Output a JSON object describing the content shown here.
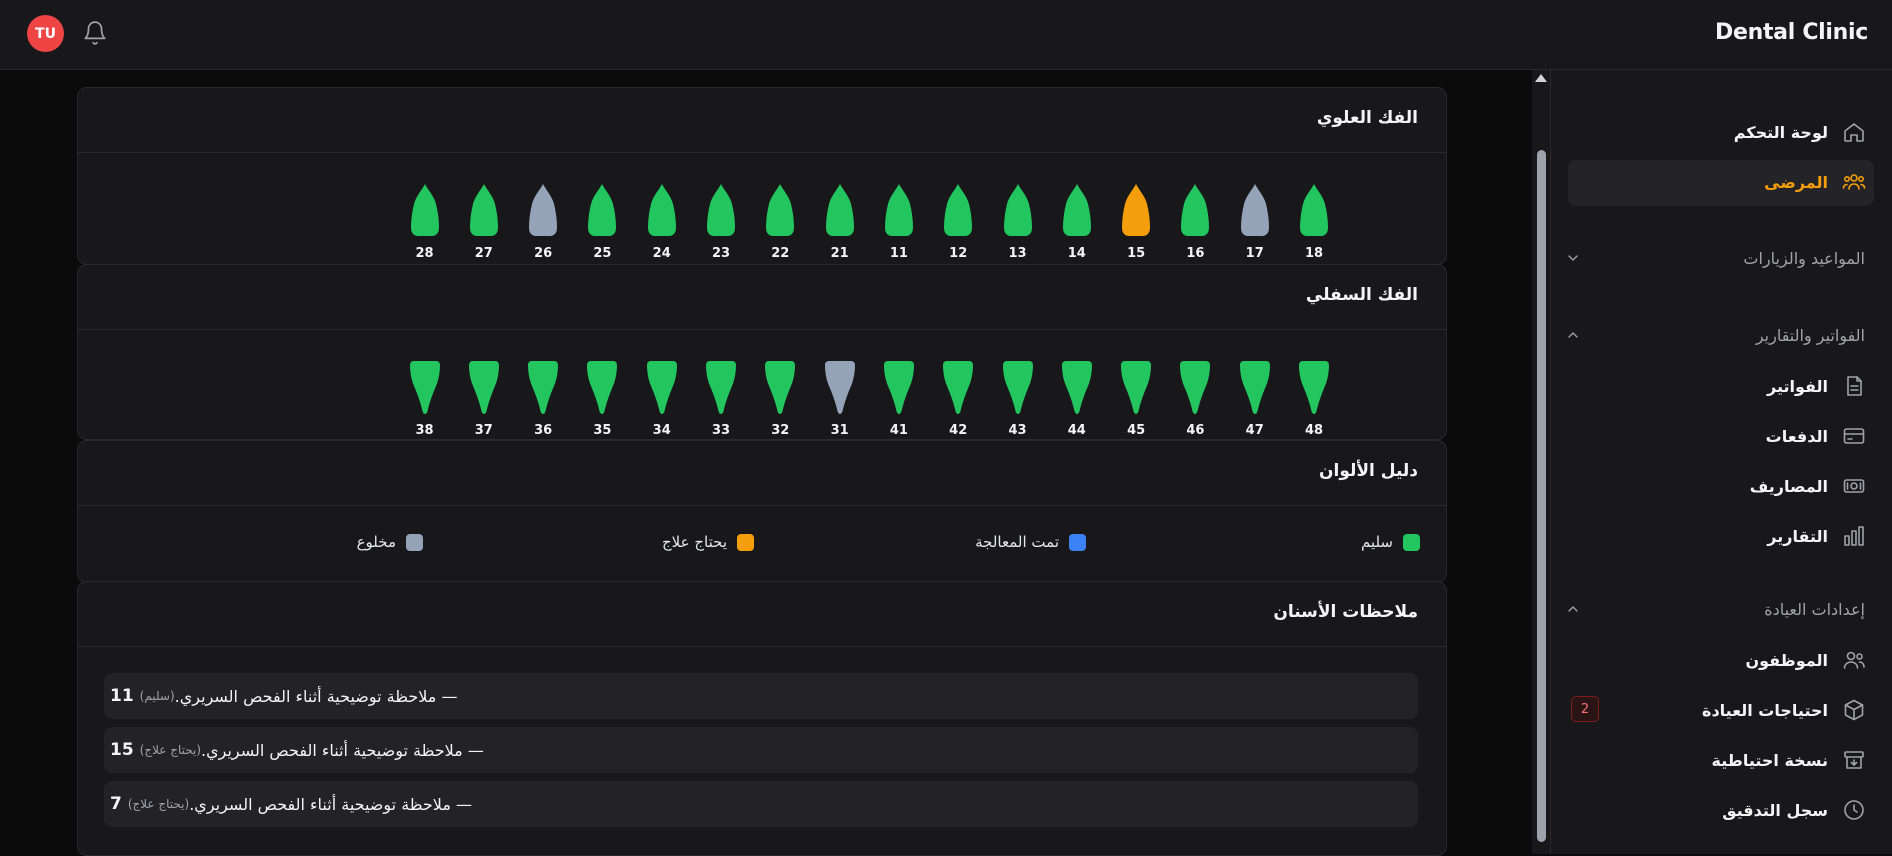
{
  "header": {
    "brand": "Dental Clinic",
    "avatar_initials": "TU",
    "avatar_color": "#ef4444",
    "bell_icon": "bell-icon"
  },
  "sidebar": {
    "items": [
      {
        "label": "لوحة التحكم",
        "icon": "home-icon"
      },
      {
        "label": "المرضى",
        "icon": "users-icon",
        "active": true,
        "color": "#f59e0b"
      }
    ],
    "sections": [
      {
        "title": "المواعيد والزيارات",
        "expanded": false
      },
      {
        "title": "الفواتير والتقارير",
        "expanded": true,
        "items": [
          {
            "label": "الفواتير",
            "icon": "document-icon"
          },
          {
            "label": "الدفعات",
            "icon": "credit-card-icon"
          },
          {
            "label": "المصاريف",
            "icon": "cash-icon"
          },
          {
            "label": "التقارير",
            "icon": "bar-chart-icon"
          }
        ]
      },
      {
        "title": "إعدادات العيادة",
        "expanded": true,
        "items": [
          {
            "label": "الموظفون",
            "icon": "users-icon"
          },
          {
            "label": "احتياجات العيادة",
            "icon": "box-icon",
            "badge": "2"
          },
          {
            "label": "نسخة احتياطية",
            "icon": "archive-icon"
          },
          {
            "label": "سجل التدقيق",
            "icon": "clock-icon"
          }
        ]
      }
    ]
  },
  "upper_jaw": {
    "title": "الفك العلوي",
    "teeth": [
      {
        "num": "18",
        "status": "healthy"
      },
      {
        "num": "17",
        "status": "extracted"
      },
      {
        "num": "16",
        "status": "healthy"
      },
      {
        "num": "15",
        "status": "needs_treatment"
      },
      {
        "num": "14",
        "status": "healthy"
      },
      {
        "num": "13",
        "status": "healthy"
      },
      {
        "num": "12",
        "status": "healthy"
      },
      {
        "num": "11",
        "status": "healthy"
      },
      {
        "num": "21",
        "status": "healthy"
      },
      {
        "num": "22",
        "status": "healthy"
      },
      {
        "num": "23",
        "status": "healthy"
      },
      {
        "num": "24",
        "status": "healthy"
      },
      {
        "num": "25",
        "status": "healthy"
      },
      {
        "num": "26",
        "status": "extracted"
      },
      {
        "num": "27",
        "status": "healthy"
      },
      {
        "num": "28",
        "status": "healthy"
      }
    ]
  },
  "lower_jaw": {
    "title": "الفك السفلي",
    "teeth": [
      {
        "num": "48",
        "status": "healthy"
      },
      {
        "num": "47",
        "status": "healthy"
      },
      {
        "num": "46",
        "status": "healthy"
      },
      {
        "num": "45",
        "status": "healthy"
      },
      {
        "num": "44",
        "status": "healthy"
      },
      {
        "num": "43",
        "status": "healthy"
      },
      {
        "num": "42",
        "status": "healthy"
      },
      {
        "num": "41",
        "status": "healthy"
      },
      {
        "num": "31",
        "status": "extracted"
      },
      {
        "num": "32",
        "status": "healthy"
      },
      {
        "num": "33",
        "status": "healthy"
      },
      {
        "num": "34",
        "status": "healthy"
      },
      {
        "num": "35",
        "status": "healthy"
      },
      {
        "num": "36",
        "status": "healthy"
      },
      {
        "num": "37",
        "status": "healthy"
      },
      {
        "num": "38",
        "status": "healthy"
      }
    ]
  },
  "status_colors": {
    "healthy": "#22c55e",
    "treated": "#3b82f6",
    "needs_treatment": "#f59e0b",
    "extracted": "#94a3b8"
  },
  "legend": {
    "title": "دليل الألوان",
    "items": [
      {
        "label": "سليم",
        "color": "#22c55e"
      },
      {
        "label": "تمت المعالجة",
        "color": "#3b82f6"
      },
      {
        "label": "يحتاج علاج",
        "color": "#f59e0b"
      },
      {
        "label": "مخلوع",
        "color": "#94a3b8"
      }
    ]
  },
  "notes": {
    "title": "ملاحظات الأسنان",
    "items": [
      {
        "num": "11",
        "status": "(سليم)",
        "text": "— ملاحظة توضيحية أثناء الفحص السريري."
      },
      {
        "num": "15",
        "status": "(يحتاج علاج)",
        "text": "— ملاحظة توضيحية أثناء الفحص السريري."
      },
      {
        "num": "7",
        "status": "(يحتاج علاج)",
        "text": "— ملاحظة توضيحية أثناء الفحص السريري."
      }
    ]
  }
}
